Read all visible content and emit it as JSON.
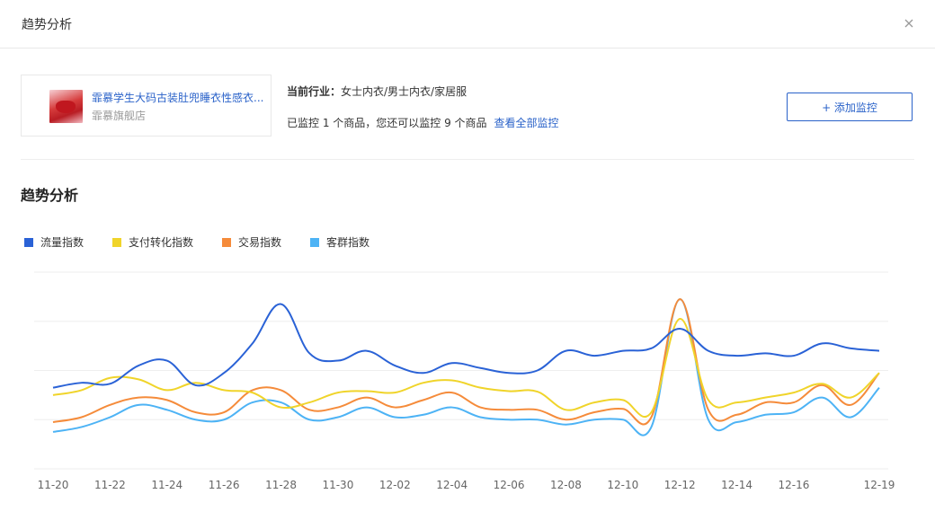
{
  "modal": {
    "title": "趋势分析"
  },
  "product": {
    "name": "霏慕学生大码古装肚兜睡衣性感衣...",
    "shop": "霏慕旗舰店"
  },
  "industry": {
    "label": "当前行业：",
    "value": "女士内衣/男士内衣/家居服"
  },
  "monitor": {
    "text": "已监控 1 个商品，您还可以监控 9 个商品",
    "link": "查看全部监控",
    "add_button": "+ 添加监控"
  },
  "section": {
    "title": "趋势分析"
  },
  "colors": {
    "流量指数": "#2a62d6",
    "支付转化指数": "#f0d42a",
    "交易指数": "#f58b3a",
    "客群指数": "#4db3f5"
  },
  "chart_data": {
    "type": "line",
    "title": "",
    "xlabel": "",
    "ylabel": "",
    "grid": true,
    "legend": "top-left",
    "x": [
      "11-20",
      "11-21",
      "11-22",
      "11-23",
      "11-24",
      "11-25",
      "11-26",
      "11-27",
      "11-28",
      "11-29",
      "11-30",
      "12-01",
      "12-02",
      "12-03",
      "12-04",
      "12-05",
      "12-06",
      "12-07",
      "12-08",
      "12-09",
      "12-10",
      "12-11",
      "12-12",
      "12-13",
      "12-14",
      "12-15",
      "12-16",
      "12-17",
      "12-18",
      "12-19"
    ],
    "xticks": [
      "11-20",
      "11-22",
      "11-24",
      "11-26",
      "11-28",
      "11-30",
      "12-02",
      "12-04",
      "12-06",
      "12-08",
      "12-10",
      "12-12",
      "12-14",
      "12-16",
      "12-19"
    ],
    "ylim": [
      0,
      4
    ],
    "series": [
      {
        "name": "流量指数",
        "color": "#2a62d6",
        "values": [
          1.65,
          1.75,
          1.73,
          2.1,
          2.2,
          1.7,
          1.95,
          2.55,
          3.35,
          2.35,
          2.2,
          2.4,
          2.1,
          1.95,
          2.15,
          2.05,
          1.95,
          2.0,
          2.4,
          2.3,
          2.4,
          2.45,
          2.85,
          2.4,
          2.3,
          2.35,
          2.3,
          2.55,
          2.45,
          2.4
        ]
      },
      {
        "name": "支付转化指数",
        "color": "#f0d42a",
        "values": [
          1.5,
          1.6,
          1.85,
          1.82,
          1.6,
          1.75,
          1.6,
          1.55,
          1.25,
          1.35,
          1.55,
          1.58,
          1.55,
          1.75,
          1.8,
          1.65,
          1.58,
          1.57,
          1.2,
          1.35,
          1.4,
          1.15,
          3.05,
          1.4,
          1.35,
          1.45,
          1.55,
          1.73,
          1.45,
          1.95
        ]
      },
      {
        "name": "交易指数",
        "color": "#f58b3a",
        "values": [
          0.95,
          1.05,
          1.3,
          1.45,
          1.4,
          1.15,
          1.15,
          1.6,
          1.6,
          1.2,
          1.25,
          1.45,
          1.25,
          1.4,
          1.55,
          1.25,
          1.2,
          1.2,
          1.0,
          1.15,
          1.22,
          1.05,
          3.45,
          1.2,
          1.1,
          1.35,
          1.35,
          1.7,
          1.3,
          1.95
        ]
      },
      {
        "name": "客群指数",
        "color": "#4db3f5",
        "values": [
          0.75,
          0.85,
          1.05,
          1.3,
          1.2,
          1.0,
          1.0,
          1.35,
          1.35,
          1.0,
          1.05,
          1.25,
          1.05,
          1.1,
          1.25,
          1.05,
          1.0,
          1.0,
          0.9,
          1.0,
          1.0,
          0.85,
          3.45,
          1.0,
          0.95,
          1.1,
          1.15,
          1.45,
          1.05,
          1.65
        ]
      }
    ]
  }
}
